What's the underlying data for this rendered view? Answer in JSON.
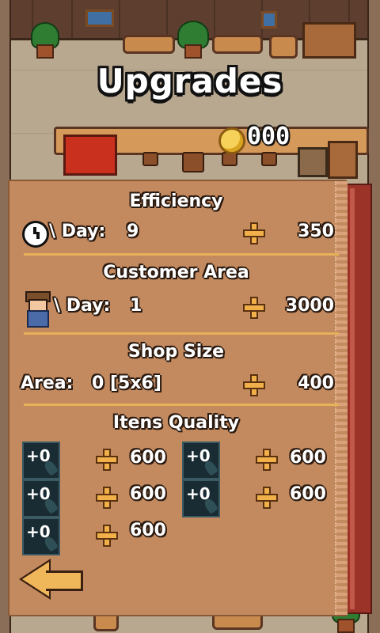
{
  "title": "Upgrades",
  "coins": "000",
  "sections": {
    "efficiency": {
      "title": "Efficiency",
      "stat_label": "\\ Day:",
      "stat_value": "9",
      "cost": "350"
    },
    "customer_area": {
      "title": "Customer Area",
      "stat_label": "\\ Day:",
      "stat_value": "1",
      "cost": "3000"
    },
    "shop_size": {
      "title": "Shop Size",
      "stat_label": "Area:",
      "stat_value": "0 [5x6]",
      "cost": "400"
    },
    "items_quality": {
      "title": "Itens Quality",
      "items": [
        {
          "level": "+0",
          "cost": "600"
        },
        {
          "level": "+0",
          "cost": "600"
        },
        {
          "level": "+0",
          "cost": "600"
        },
        {
          "level": "+0",
          "cost": "600"
        },
        {
          "level": "+0",
          "cost": "600"
        }
      ]
    }
  },
  "icons": [
    "clock-icon",
    "customer-icon",
    "plus-icon",
    "quill-icon",
    "back-arrow-icon",
    "coin-icon"
  ],
  "colors": {
    "panel": "#c48a5f",
    "divider": "#e7b15a",
    "plus": "#f2b04a",
    "coin": "#f7d25a"
  }
}
